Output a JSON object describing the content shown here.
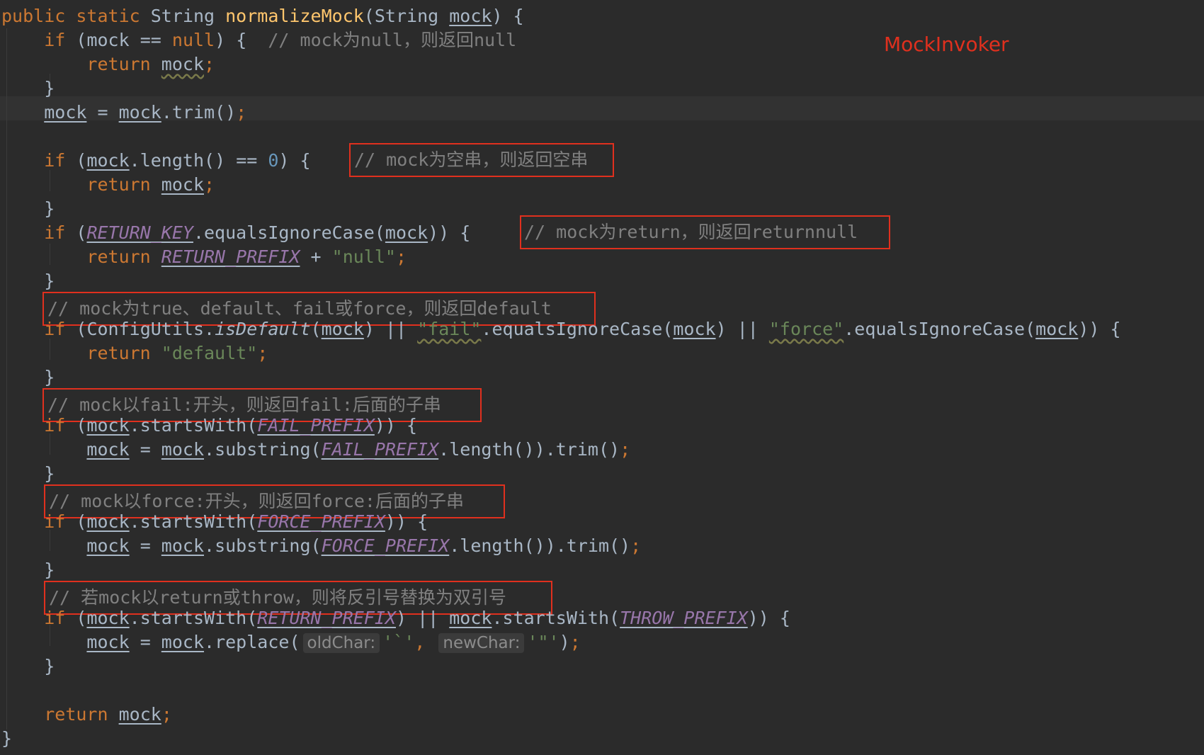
{
  "title_label": "MockInvoker",
  "code": {
    "method_sig": {
      "kw1": "public",
      "kw2": "static",
      "type": "String",
      "name": "normalizeMock",
      "param_type": "String",
      "param": "mock"
    },
    "null_check": {
      "kw": "if",
      "var": "mock",
      "op": "==",
      "lit": "null",
      "comment": "// mock为null，则返回null",
      "ret_kw": "return",
      "ret_var": "mock"
    },
    "trim_line": {
      "lhs": "mock",
      "rhs": "mock",
      "method": ".trim()"
    },
    "empty_check": {
      "kw": "if",
      "var": "mock",
      "method": ".length()",
      "op": "==",
      "num": "0",
      "comment": "// mock为空串，则返回空串",
      "ret_kw": "return",
      "ret_var": "mock"
    },
    "return_check": {
      "kw": "if",
      "const": "RETURN_KEY",
      "method": ".equalsIgnoreCase",
      "arg": "mock",
      "comment": "// mock为return，则返回returnnull",
      "ret_kw": "return",
      "ret_const": "RETURN_PREFIX",
      "plus": "+",
      "ret_str": "\"null\""
    },
    "default_check": {
      "comment": "// mock为true、default、fail或force，则返回default",
      "kw": "if",
      "cls": "ConfigUtils",
      "static_method": "isDefault",
      "arg": "mock",
      "or": "||",
      "str1": "\"fail\"",
      "method": ".equalsIgnoreCase",
      "str2": "\"force\"",
      "ret_kw": "return",
      "ret_str": "\"default\""
    },
    "fail_check": {
      "comment": "// mock以fail:开头，则返回fail:后面的子串",
      "kw": "if",
      "var": "mock",
      "method": ".startsWith",
      "const": "FAIL_PREFIX",
      "assign_var": "mock",
      "sub_method": ".substring",
      "len_method": ".length()",
      "trim": ".trim()"
    },
    "force_check": {
      "comment": "// mock以force:开头，则返回force:后面的子串",
      "kw": "if",
      "var": "mock",
      "method": ".startsWith",
      "const": "FORCE_PREFIX",
      "assign_var": "mock",
      "sub_method": ".substring",
      "len_method": ".length()",
      "trim": ".trim()"
    },
    "throw_check": {
      "comment": "// 若mock以return或throw，则将反引号替换为双引号",
      "kw": "if",
      "var": "mock",
      "method": ".startsWith",
      "const1": "RETURN_PREFIX",
      "or": "||",
      "const2": "THROW_PREFIX",
      "assign_var": "mock",
      "replace_method": ".replace",
      "hint1": "oldChar:",
      "char1": "'`'",
      "hint2": "newChar:",
      "char2": "'\"'"
    },
    "final_return": {
      "kw": "return",
      "var": "mock"
    }
  }
}
